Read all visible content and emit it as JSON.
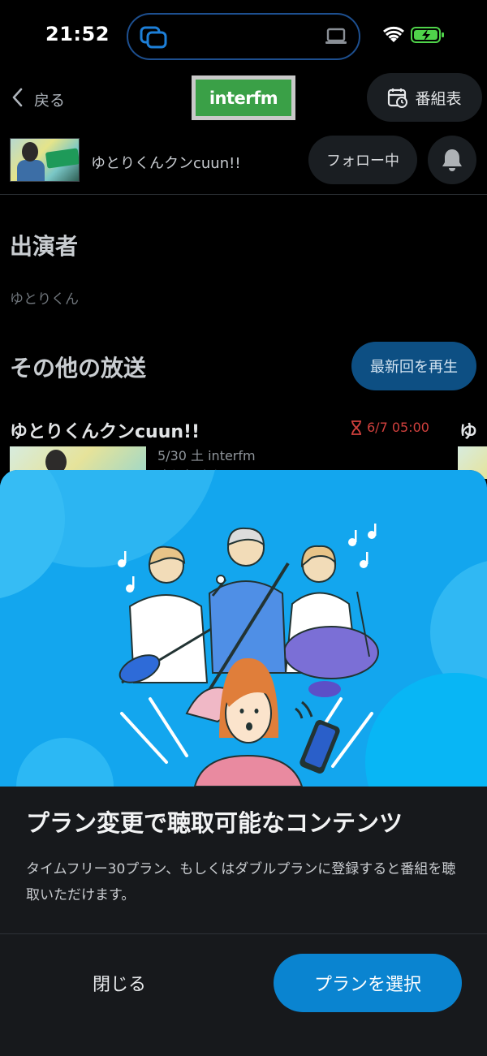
{
  "status_bar": {
    "time": "21:52"
  },
  "nav": {
    "back_label": "戻る",
    "logo_text": "interfm",
    "schedule_label": "番組表"
  },
  "program": {
    "title": "ゆとりくんクンcuun!!",
    "follow_label": "フォロー中"
  },
  "performers": {
    "heading": "出演者",
    "name": "ゆとりくん"
  },
  "other_broadcasts": {
    "heading": "その他の放送",
    "latest_button": "最新回を再生",
    "episodes": [
      {
        "title": "ゆとりくんクンcuun!!",
        "deadline": "6/7 05:00",
        "date_station": "5/30 土 interfm",
        "performer": "ゆとりくん"
      },
      {
        "title": "ゆ"
      }
    ]
  },
  "modal": {
    "title": "プラン変更で聴取可能なコンテンツ",
    "description": "タイムフリー30プラン、もしくはダブルプランに登録すると番組を聴取いただけます。",
    "close_label": "閉じる",
    "select_label": "プランを選択"
  },
  "colors": {
    "accent": "#0a84d0",
    "latest_button": "#0d4f83",
    "deadline": "#d0403d",
    "illustration_bg": "#13a6ee",
    "logo_green": "#3aa047"
  }
}
